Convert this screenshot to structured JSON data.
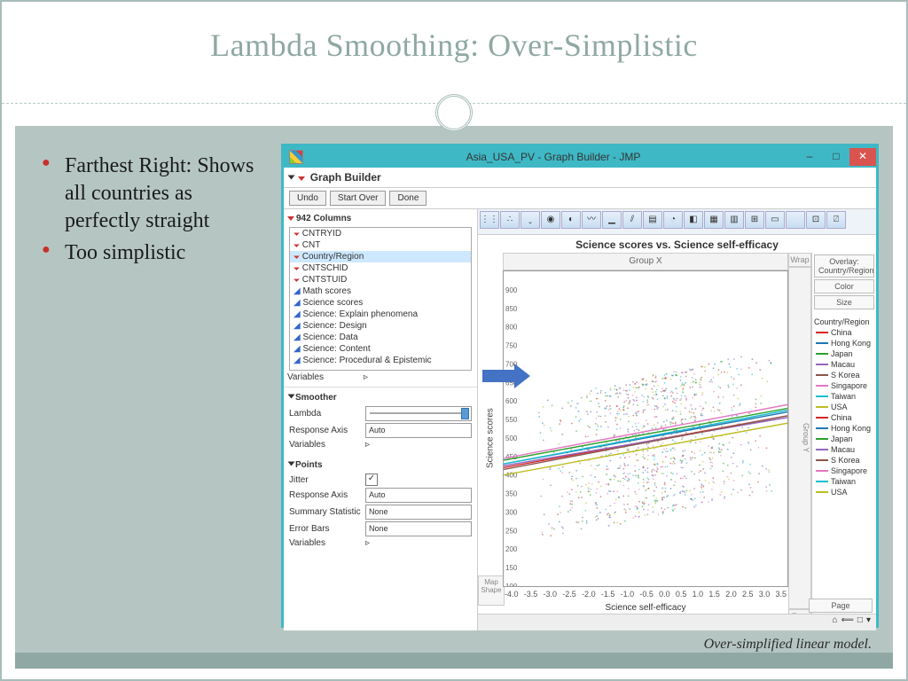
{
  "slide": {
    "title": "Lambda Smoothing: Over-Simplistic",
    "bullets": [
      "Farthest Right: Shows all countries as perfectly straight",
      "Too simplistic"
    ],
    "caption": "Over-simplified linear model."
  },
  "window": {
    "title": "Asia_USA_PV - Graph Builder - JMP",
    "section": "Graph Builder",
    "buttons": {
      "undo": "Undo",
      "start_over": "Start Over",
      "done": "Done"
    },
    "columns_header": "942 Columns",
    "columns": [
      "CNTRYID",
      "CNT",
      "Country/Region",
      "CNTSCHID",
      "CNTSTUID",
      "Math scores",
      "Science scores",
      "Science: Explain phenomena",
      "Science: Design",
      "Science: Data",
      "Science: Content",
      "Science: Procedural & Epistemic"
    ],
    "columns_selected": "Country/Region",
    "variables_label": "Variables",
    "smoother": {
      "header": "Smoother",
      "lambda": "Lambda",
      "response_axis": "Response Axis",
      "response_axis_val": "Auto",
      "variables": "Variables"
    },
    "points": {
      "header": "Points",
      "jitter": "Jitter",
      "response_axis": "Response Axis",
      "response_axis_val": "Auto",
      "summary": "Summary Statistic",
      "summary_val": "None",
      "error_bars": "Error Bars",
      "error_bars_val": "None",
      "variables": "Variables"
    }
  },
  "chart": {
    "title": "Science scores vs. Science self-efficacy",
    "groupx": "Group X",
    "groupy": "Group Y",
    "wrap": "Wrap",
    "overlay": "Overlay: Country/Region",
    "color": "Color",
    "size": "Size",
    "page": "Page",
    "freq": "Freq",
    "ylabel": "Science scores",
    "xlabel": "Science self-efficacy",
    "xticks": [
      "-4.0",
      "-3.5",
      "-3.0",
      "-2.5",
      "-2.0",
      "-1.5",
      "-1.0",
      "-0.5",
      "0.0",
      "0.5",
      "1.0",
      "1.5",
      "2.0",
      "2.5",
      "3.0",
      "3.5"
    ],
    "yticks": [
      "900",
      "850",
      "800",
      "750",
      "700",
      "650",
      "600",
      "550",
      "500",
      "450",
      "400",
      "350",
      "300",
      "250",
      "200",
      "150",
      "100"
    ],
    "map": "Map",
    "shape": "Shape",
    "legend_header": "Country/Region",
    "legend": [
      {
        "name": "China",
        "color": "#d62728"
      },
      {
        "name": "Hong Kong",
        "color": "#1f77b4"
      },
      {
        "name": "Japan",
        "color": "#2ca02c"
      },
      {
        "name": "Macau",
        "color": "#9467bd"
      },
      {
        "name": "S Korea",
        "color": "#8c564b"
      },
      {
        "name": "Singapore",
        "color": "#e377c2"
      },
      {
        "name": "Taiwan",
        "color": "#17becf"
      },
      {
        "name": "USA",
        "color": "#bcbd22"
      },
      {
        "name": "China",
        "color": "#d62728"
      },
      {
        "name": "Hong Kong",
        "color": "#1f77b4"
      },
      {
        "name": "Japan",
        "color": "#2ca02c"
      },
      {
        "name": "Macau",
        "color": "#9467bd"
      },
      {
        "name": "S Korea",
        "color": "#8c564b"
      },
      {
        "name": "Singapore",
        "color": "#e377c2"
      },
      {
        "name": "Taiwan",
        "color": "#17becf"
      },
      {
        "name": "USA",
        "color": "#bcbd22"
      }
    ]
  },
  "chart_data": {
    "type": "scatter",
    "title": "Science scores vs. Science self-efficacy",
    "xlabel": "Science self-efficacy",
    "ylabel": "Science scores",
    "xlim": [
      -4.0,
      3.5
    ],
    "ylim": [
      100,
      950
    ],
    "overlay": "Country/Region",
    "note": "Dense jittered scatter of ~thousands of points across discrete survey values; smoother at max lambda yields near-linear fits per country",
    "fit_lines": [
      {
        "name": "China",
        "color": "#d62728",
        "y_at_xmin": 420,
        "y_at_xmax": 560
      },
      {
        "name": "Hong Kong",
        "color": "#1f77b4",
        "y_at_xmin": 430,
        "y_at_xmax": 570
      },
      {
        "name": "Japan",
        "color": "#2ca02c",
        "y_at_xmin": 440,
        "y_at_xmax": 580
      },
      {
        "name": "Macau",
        "color": "#9467bd",
        "y_at_xmin": 425,
        "y_at_xmax": 555
      },
      {
        "name": "S Korea",
        "color": "#8c564b",
        "y_at_xmin": 415,
        "y_at_xmax": 560
      },
      {
        "name": "Singapore",
        "color": "#e377c2",
        "y_at_xmin": 445,
        "y_at_xmax": 590
      },
      {
        "name": "Taiwan",
        "color": "#17becf",
        "y_at_xmin": 430,
        "y_at_xmax": 575
      },
      {
        "name": "USA",
        "color": "#bcbd22",
        "y_at_xmin": 400,
        "y_at_xmax": 540
      }
    ]
  }
}
